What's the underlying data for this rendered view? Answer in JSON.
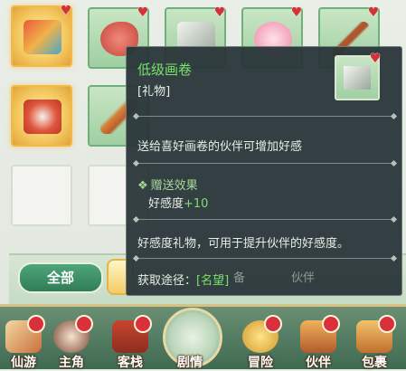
{
  "inventory": {
    "slots": [
      {
        "icon": "gift-box-icon",
        "favorite": true,
        "rarity": "gold"
      },
      {
        "icon": "meat-icon",
        "favorite": true,
        "rarity": "green"
      },
      {
        "icon": "painting-scroll-icon",
        "favorite": true,
        "rarity": "green"
      },
      {
        "icon": "flower-icon",
        "favorite": true,
        "rarity": "green"
      },
      {
        "icon": "bow-icon",
        "favorite": true,
        "rarity": "green"
      },
      {
        "icon": "armor-icon",
        "favorite": false,
        "rarity": "gold"
      },
      {
        "icon": "wooden-stick-icon",
        "favorite": false,
        "rarity": "green"
      }
    ],
    "filters": {
      "all_label": "全部",
      "ghost_labels": [
        "备",
        "伙伴"
      ]
    }
  },
  "tooltip": {
    "name": "低级画卷",
    "kind": "[礼物]",
    "description": "送给喜好画卷的伙伴可增加好感",
    "effect_title": "赠送效果",
    "effect_label": "好感度",
    "effect_value": "+10",
    "usage": "好感度礼物，可用于提升伙伴的好感度。",
    "source_label": "获取途径：",
    "source_value": "[名望]",
    "name_color": "#78e36c"
  },
  "nav": {
    "items": [
      {
        "label": "仙游",
        "icon": "scroll-book-icon",
        "badge": true
      },
      {
        "label": "主角",
        "icon": "hero-portrait-icon",
        "badge": true
      },
      {
        "label": "客栈",
        "icon": "inn-building-icon",
        "badge": true
      },
      {
        "label": "剧情",
        "icon": "story-landscape-icon",
        "badge": false
      },
      {
        "label": "冒险",
        "icon": "gourd-icon",
        "badge": true
      },
      {
        "label": "伙伴",
        "icon": "companion-portrait-icon",
        "badge": true
      },
      {
        "label": "包裹",
        "icon": "bag-icon",
        "badge": true
      }
    ]
  }
}
